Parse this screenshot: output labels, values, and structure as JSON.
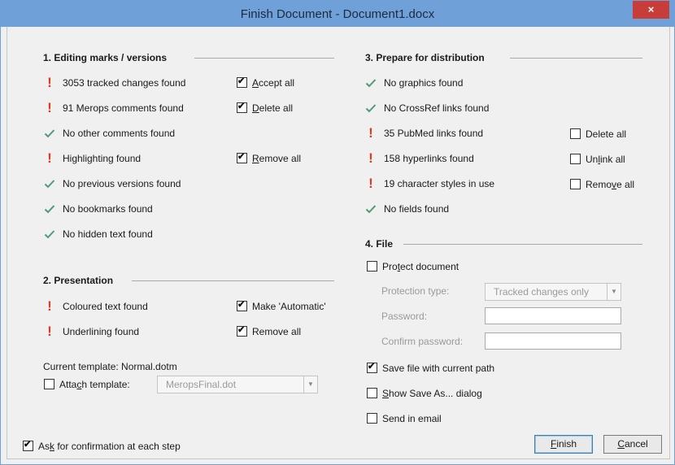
{
  "window": {
    "title": "Finish Document - Document1.docx",
    "close_label": "×"
  },
  "section1": {
    "heading": "1. Editing marks / versions",
    "items": [
      {
        "status": "warn",
        "text": "3053 tracked changes found"
      },
      {
        "status": "warn",
        "text": "91 Merops comments found"
      },
      {
        "status": "ok",
        "text": "No other comments found"
      },
      {
        "status": "warn",
        "text": "Highlighting found"
      },
      {
        "status": "ok",
        "text": "No previous versions found"
      },
      {
        "status": "ok",
        "text": "No bookmarks found"
      },
      {
        "status": "ok",
        "text": "No hidden text found"
      }
    ],
    "accept_all": {
      "pre": "",
      "u": "A",
      "post": "ccept all",
      "checked": true
    },
    "delete_all": {
      "pre": "",
      "u": "D",
      "post": "elete all",
      "checked": true
    },
    "remove_all": {
      "pre": "",
      "u": "R",
      "post": "emove all",
      "checked": true
    }
  },
  "section2": {
    "heading": "2. Presentation",
    "items": [
      {
        "status": "warn",
        "text": "Coloured text found"
      },
      {
        "status": "warn",
        "text": "Underlining found"
      }
    ],
    "make_automatic": {
      "label": "Make 'Automatic'",
      "checked": true
    },
    "remove_all": {
      "label": "Remove all",
      "checked": true
    },
    "current_template": "Current template: Normal.dotm",
    "attach_template": {
      "pre": "Atta",
      "u": "c",
      "post": "h template:",
      "checked": false
    },
    "template_value": "MeropsFinal.dot"
  },
  "section3": {
    "heading": "3. Prepare for distribution",
    "items": [
      {
        "status": "ok",
        "text": "No graphics found"
      },
      {
        "status": "ok",
        "text": "No CrossRef links found"
      },
      {
        "status": "warn",
        "text": "35 PubMed links found"
      },
      {
        "status": "warn",
        "text": "158 hyperlinks found"
      },
      {
        "status": "warn",
        "text": "19 character styles in use"
      },
      {
        "status": "ok",
        "text": "No fields found"
      }
    ],
    "delete_all": {
      "label": "Delete all",
      "checked": false
    },
    "unlink_all": {
      "pre": "Un",
      "u": "l",
      "post": "ink all",
      "checked": false
    },
    "remove_all": {
      "pre": "Remo",
      "u": "v",
      "post": "e all",
      "checked": false
    }
  },
  "section4": {
    "heading": "4. File",
    "protect": {
      "pre": "Pro",
      "u": "t",
      "post": "ect document",
      "checked": false
    },
    "protection_type_label": "Protection type:",
    "protection_type_value": "Tracked changes only",
    "password_label": "Password:",
    "confirm_label": "Confirm password:",
    "save_current": {
      "label": "Save file with current path",
      "checked": true
    },
    "show_save_as": {
      "pre": "",
      "u": "S",
      "post": "how Save As... dialog",
      "checked": false
    },
    "send_email": {
      "label": "Send in email",
      "checked": false
    }
  },
  "footer": {
    "ask_confirm": {
      "pre": "As",
      "u": "k",
      "post": " for confirmation at each step",
      "checked": true
    },
    "finish": {
      "pre": "",
      "u": "F",
      "post": "inish"
    },
    "cancel": {
      "pre": "",
      "u": "C",
      "post": "ancel"
    }
  }
}
